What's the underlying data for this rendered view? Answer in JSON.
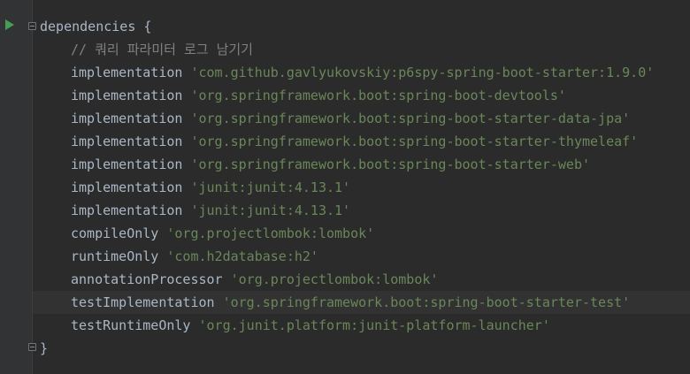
{
  "editor": {
    "block_open": "dependencies {",
    "comment": "// 쿼리 파라미터 로그 남기기",
    "lines": [
      {
        "config": "implementation",
        "artifact": "'com.github.gavlyukovskiy:p6spy-spring-boot-starter:1.9.0'"
      },
      {
        "config": "implementation",
        "artifact": "'org.springframework.boot:spring-boot-devtools'"
      },
      {
        "config": "implementation",
        "artifact": "'org.springframework.boot:spring-boot-starter-data-jpa'"
      },
      {
        "config": "implementation",
        "artifact": "'org.springframework.boot:spring-boot-starter-thymeleaf'"
      },
      {
        "config": "implementation",
        "artifact": "'org.springframework.boot:spring-boot-starter-web'"
      },
      {
        "config": "implementation",
        "artifact": "'junit:junit:4.13.1'"
      },
      {
        "config": "implementation",
        "artifact": "'junit:junit:4.13.1'"
      },
      {
        "config": "compileOnly",
        "artifact": "'org.projectlombok:lombok'"
      },
      {
        "config": "runtimeOnly",
        "artifact": "'com.h2database:h2'"
      },
      {
        "config": "annotationProcessor",
        "artifact": "'org.projectlombok:lombok'"
      },
      {
        "config": "testImplementation",
        "artifact": "'org.springframework.boot:spring-boot-starter-test'"
      },
      {
        "config": "testRuntimeOnly",
        "artifact": "'org.junit.platform:junit-platform-launcher'"
      }
    ],
    "block_close": "}"
  },
  "icons": {
    "run": "run-gutter-icon",
    "fold_open": "fold-open-icon",
    "fold_close": "fold-close-icon"
  },
  "colors": {
    "background": "#2b2b2b",
    "gutter": "#313335",
    "keyword": "#a9b7c6",
    "string": "#6a8759",
    "comment": "#808080",
    "run_icon": "#499c54"
  }
}
